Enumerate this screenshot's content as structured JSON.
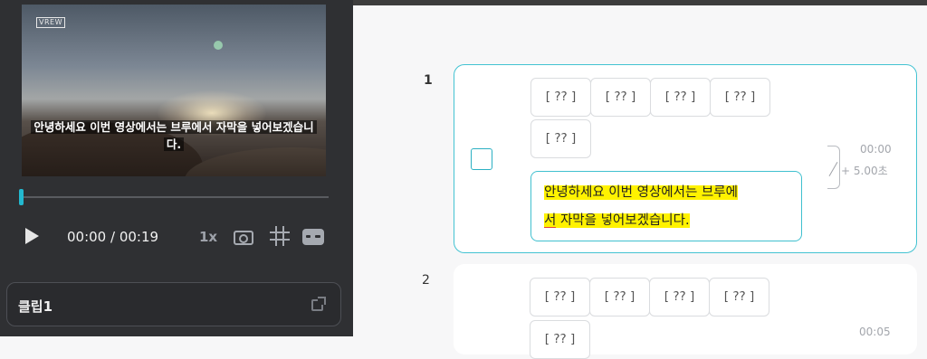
{
  "player": {
    "logo": "VREW",
    "caption": "안녕하세요 이번 영상에서는 브루에서 자막을 넣어보겠습니다.",
    "current_time": "00:00",
    "total_time": "/ 00:19",
    "speed": "1x",
    "progress": 0.0
  },
  "clip": {
    "label": "클립1"
  },
  "rows": [
    {
      "number": "1",
      "tokens": [
        "[ ?? ]",
        "[ ?? ]",
        "[ ?? ]",
        "[ ?? ]",
        "[ ?? ]"
      ],
      "text_line1": "안녕하세요 이번 영상에서는 브루에",
      "text_line2_underlined": "서",
      "text_line2_rest": " 자막을 넣어보겠습니다.",
      "start_time": "00:00",
      "duration": "+ 5.00초"
    },
    {
      "number": "2",
      "tokens": [
        "[ ?? ]",
        "[ ?? ]",
        "[ ?? ]",
        "[ ?? ]",
        "[ ?? ]"
      ],
      "start_time": "00:05"
    }
  ],
  "colors": {
    "accent": "#23b8cf",
    "highlight": "#fff200",
    "left_panel": "#2f3033"
  }
}
